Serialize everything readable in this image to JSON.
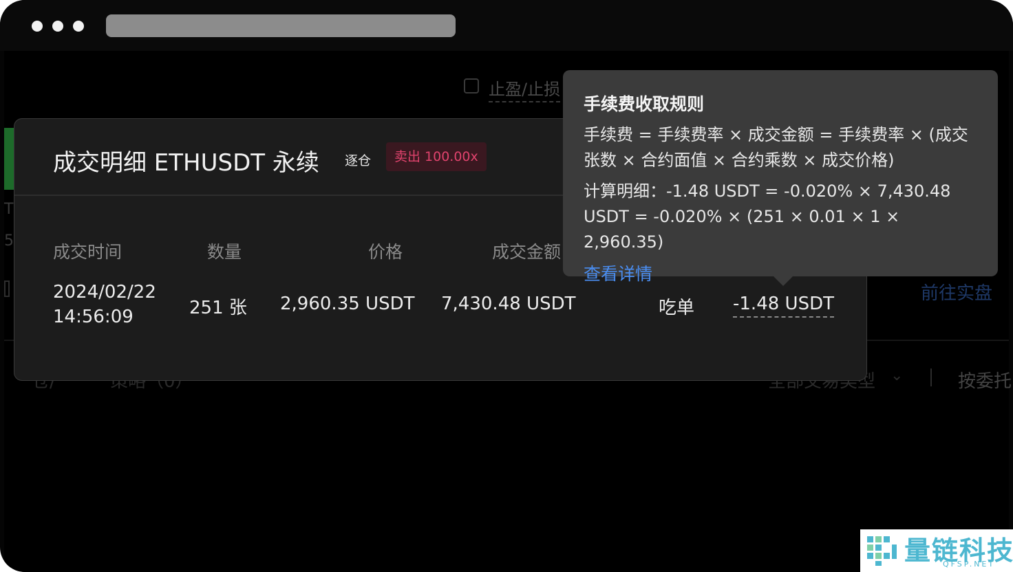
{
  "background": {
    "tpsl_label": "止盈/止损",
    "letter_t": "T",
    "letter_5": "5",
    "live_link": "前往实盘",
    "row_left_a": "仓/",
    "row_left_b": "策略（0）",
    "trade_type": "全部交易类型",
    "entrust_label": "按委托"
  },
  "modal": {
    "title": "成交明细 ETHUSDT 永续",
    "margin_mode": "逐仓",
    "side_tag": "卖出 100.00x",
    "columns": [
      "成交时间",
      "数量",
      "价格",
      "成交金额"
    ],
    "row": {
      "date": "2024/02/22",
      "time": "14:56:09",
      "quantity": "251 张",
      "price": "2,960.35 USDT",
      "amount": "7,430.48 USDT",
      "liquidity": "吃单",
      "fee": "-1.48 USDT"
    }
  },
  "tooltip": {
    "title": "手续费收取规则",
    "formula": "手续费 = 手续费率 × 成交金额 = 手续费率 × (成交张数 × 合约面值 × 合约乘数 × 成交价格)",
    "calc": "计算明细：-1.48 USDT = -0.020% × 7,430.48 USDT = -0.020% × (251 × 0.01 × 1 × 2,960.35)",
    "link": "查看详情"
  },
  "watermark": {
    "name": "量链科技",
    "sub": "QFSP.NET"
  },
  "colors": {
    "sell_accent": "#e0436d",
    "link_blue": "#4a8df0",
    "watermark": "#4db7d0"
  }
}
